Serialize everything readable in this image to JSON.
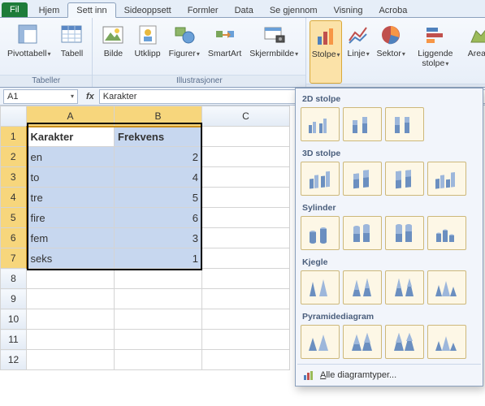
{
  "tabs": {
    "file": "Fil",
    "home": "Hjem",
    "insert": "Sett inn",
    "layout": "Sideoppsett",
    "formulas": "Formler",
    "data": "Data",
    "review": "Se gjennom",
    "view": "Visning",
    "acrobat": "Acroba"
  },
  "ribbon": {
    "groups": {
      "tables": "Tabeller",
      "illustrations": "Illustrasjoner",
      "charts": ""
    },
    "buttons": {
      "pivot": "Pivottabell",
      "table": "Tabell",
      "picture": "Bilde",
      "clipart": "Utklipp",
      "shapes": "Figurer",
      "smartart": "SmartArt",
      "screenshot": "Skjermbilde",
      "column": "Stolpe",
      "line": "Linje",
      "pie": "Sektor",
      "bar": "Liggende stolpe",
      "area": "Areal"
    }
  },
  "formula_bar": {
    "name_box": "A1",
    "fx": "fx",
    "value": "Karakter"
  },
  "grid": {
    "columns": [
      "A",
      "B",
      "C"
    ],
    "rows": [
      "1",
      "2",
      "3",
      "4",
      "5",
      "6",
      "7",
      "8",
      "9",
      "10",
      "11",
      "12"
    ],
    "headers": {
      "a": "Karakter",
      "b": "Frekvens"
    },
    "data": [
      {
        "a": "en",
        "b": "2"
      },
      {
        "a": "to",
        "b": "4"
      },
      {
        "a": "tre",
        "b": "5"
      },
      {
        "a": "fire",
        "b": "6"
      },
      {
        "a": "fem",
        "b": "3"
      },
      {
        "a": "seks",
        "b": "1"
      }
    ]
  },
  "panel": {
    "sections": {
      "s2d": "2D stolpe",
      "s3d": "3D stolpe",
      "cyl": "Sylinder",
      "cone": "Kjegle",
      "pyr": "Pyramidediagram"
    },
    "footer": "Alle diagramtyper..."
  },
  "chart_data": {
    "type": "bar",
    "title": "",
    "categories": [
      "en",
      "to",
      "tre",
      "fire",
      "fem",
      "seks"
    ],
    "values": [
      2,
      4,
      5,
      6,
      3,
      1
    ],
    "xlabel": "Karakter",
    "ylabel": "Frekvens",
    "ylim": [
      0,
      6
    ]
  }
}
